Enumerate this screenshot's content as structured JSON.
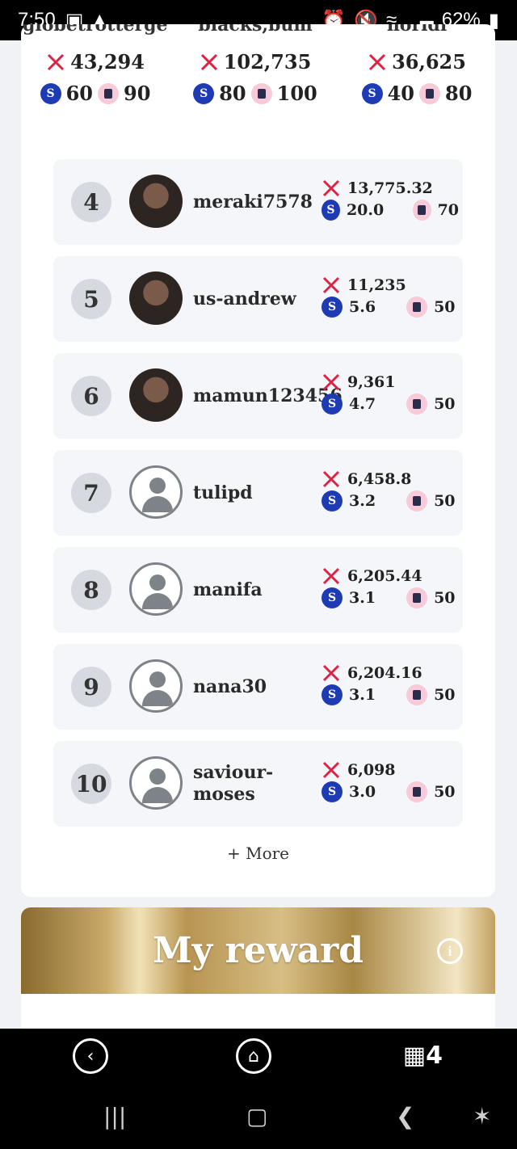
{
  "status": {
    "time": "7:50",
    "battery": "62%"
  },
  "podium": [
    {
      "name": "globetrotterger",
      "score": "43,294",
      "steem": "60",
      "mascot": "90"
    },
    {
      "name": "blacks,bum",
      "score": "102,735",
      "steem": "80",
      "mascot": "100"
    },
    {
      "name": "horidi",
      "score": "36,625",
      "steem": "40",
      "mascot": "80"
    }
  ],
  "rows": [
    {
      "rank": "4",
      "name": "meraki7578",
      "score": "13,775.32",
      "steem": "20.0",
      "mascot": "70",
      "avatar": "photo"
    },
    {
      "rank": "5",
      "name": "us-andrew",
      "score": "11,235",
      "steem": "5.6",
      "mascot": "50",
      "avatar": "photo"
    },
    {
      "rank": "6",
      "name": "mamun123456",
      "score": "9,361",
      "steem": "4.7",
      "mascot": "50",
      "avatar": "photo"
    },
    {
      "rank": "7",
      "name": "tulipd",
      "score": "6,458.8",
      "steem": "3.2",
      "mascot": "50",
      "avatar": "default"
    },
    {
      "rank": "8",
      "name": "manifa",
      "score": "6,205.44",
      "steem": "3.1",
      "mascot": "50",
      "avatar": "default"
    },
    {
      "rank": "9",
      "name": "nana30",
      "score": "6,204.16",
      "steem": "3.1",
      "mascot": "50",
      "avatar": "default"
    },
    {
      "rank": "10",
      "name": "saviour-moses",
      "score": "6,098",
      "steem": "3.0",
      "mascot": "50",
      "avatar": "default"
    }
  ],
  "more_label": "+ More",
  "reward": {
    "title": "My reward",
    "info": "i"
  },
  "browser": {
    "tabs": "4"
  },
  "colors": {
    "gold": "#c9aa6b",
    "steem_blue": "#1f3bb3",
    "row_bg": "#f5f6fa"
  }
}
